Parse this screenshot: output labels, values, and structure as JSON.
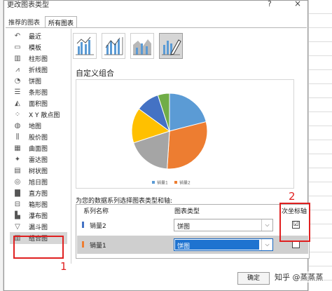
{
  "dialog": {
    "title": "更改图表类型",
    "help": "?",
    "close": "×"
  },
  "tabs": [
    {
      "label": "推荐的图表",
      "active": false
    },
    {
      "label": "所有图表",
      "active": true
    }
  ],
  "chart_types": [
    {
      "label": "最近",
      "icon": "undo-icon",
      "glyph": "↶",
      "selected": false
    },
    {
      "label": "模板",
      "icon": "folder-icon",
      "glyph": "▭",
      "selected": false
    },
    {
      "label": "柱形图",
      "icon": "column-chart-icon",
      "glyph": "▥",
      "selected": false
    },
    {
      "label": "折线图",
      "icon": "line-chart-icon",
      "glyph": "⩘",
      "selected": false
    },
    {
      "label": "饼图",
      "icon": "pie-chart-icon",
      "glyph": "◔",
      "selected": false
    },
    {
      "label": "条形图",
      "icon": "bar-chart-icon",
      "glyph": "☰",
      "selected": false
    },
    {
      "label": "面积图",
      "icon": "area-chart-icon",
      "glyph": "◭",
      "selected": false
    },
    {
      "label": "X Y 散点图",
      "icon": "scatter-chart-icon",
      "glyph": "⁘",
      "selected": false
    },
    {
      "label": "地图",
      "icon": "map-chart-icon",
      "glyph": "◍",
      "selected": false
    },
    {
      "label": "股价图",
      "icon": "stock-chart-icon",
      "glyph": "⫼",
      "selected": false
    },
    {
      "label": "曲面图",
      "icon": "surface-chart-icon",
      "glyph": "▦",
      "selected": false
    },
    {
      "label": "雷达图",
      "icon": "radar-chart-icon",
      "glyph": "✦",
      "selected": false
    },
    {
      "label": "树状图",
      "icon": "treemap-chart-icon",
      "glyph": "▤",
      "selected": false
    },
    {
      "label": "旭日图",
      "icon": "sunburst-chart-icon",
      "glyph": "◎",
      "selected": false
    },
    {
      "label": "直方图",
      "icon": "histogram-chart-icon",
      "glyph": "▇",
      "selected": false
    },
    {
      "label": "箱形图",
      "icon": "box-whisker-chart-icon",
      "glyph": "⊟",
      "selected": false
    },
    {
      "label": "瀑布图",
      "icon": "waterfall-chart-icon",
      "glyph": "▙",
      "selected": false
    },
    {
      "label": "漏斗图",
      "icon": "funnel-chart-icon",
      "glyph": "▽",
      "selected": false
    },
    {
      "label": "组合图",
      "icon": "combo-chart-icon",
      "glyph": "▥",
      "selected": true
    }
  ],
  "section_title": "自定义组合",
  "preview_legend": [
    "销量1",
    "销量2"
  ],
  "prompt": "为您的数据系列选择图表类型和轴:",
  "table": {
    "col_series": "系列名称",
    "col_type": "图表类型",
    "col_axis": "次坐标轴",
    "rows": [
      {
        "name": "销量2",
        "color": "#4472c4",
        "type": "饼图",
        "secondary": true,
        "secondary_mark": "☑",
        "selected": false
      },
      {
        "name": "销量1",
        "color": "#ed7d31",
        "type": "饼图",
        "secondary": false,
        "secondary_mark": "",
        "selected": true
      }
    ]
  },
  "annotations": {
    "one": "1",
    "two": "2"
  },
  "ok_label": "确定",
  "watermark": "知乎 @蒸蒸蒸",
  "pie": {
    "colors": [
      "#5b9bd5",
      "#ed7d31",
      "#a5a5a5",
      "#ffc000",
      "#4472c4",
      "#70ad47"
    ],
    "shares": [
      0.21,
      0.3,
      0.19,
      0.15,
      0.1,
      0.05
    ]
  }
}
